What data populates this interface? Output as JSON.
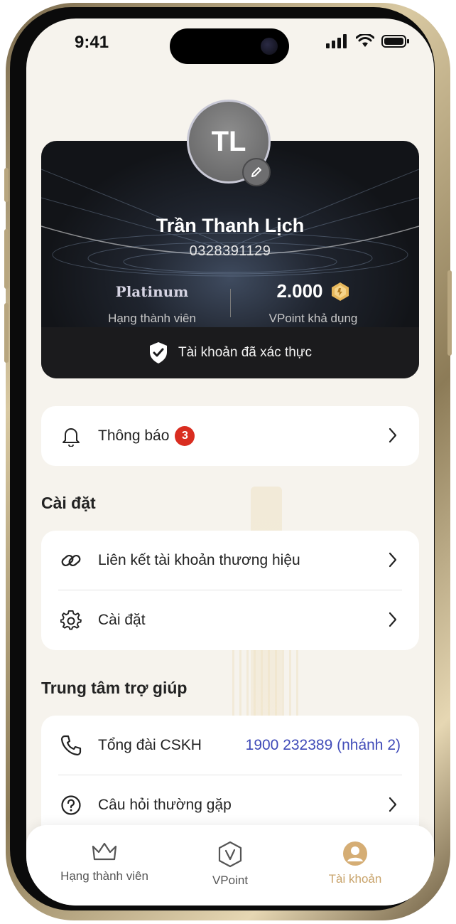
{
  "status_bar": {
    "time": "9:41"
  },
  "profile": {
    "initials": "TL",
    "name": "Trần Thanh Lịch",
    "phone": "0328391129",
    "tier": "Platinum",
    "tier_label": "Hạng thành viên",
    "vpoint": "2.000",
    "vpoint_label": "VPoint khả dụng",
    "verified_text": "Tài khoản đã xác thực"
  },
  "notifications": {
    "label": "Thông báo",
    "count": "3"
  },
  "settings": {
    "title": "Cài đặt",
    "items": [
      {
        "label": "Liên kết tài khoản thương hiệu",
        "icon": "link-icon"
      },
      {
        "label": "Cài đặt",
        "icon": "gear-icon"
      }
    ]
  },
  "help": {
    "title": "Trung tâm trợ giúp",
    "hotline_label": "Tổng đài CSKH",
    "hotline_value": "1900 232389 (nhánh 2)",
    "faq_label": "Câu hỏi thường gặp"
  },
  "bottom_nav": {
    "items": [
      {
        "label": "Hạng thành viên",
        "icon": "crown-icon"
      },
      {
        "label": "VPoint",
        "icon": "vpoint-icon"
      },
      {
        "label": "Tài khoản",
        "icon": "account-icon",
        "active": true
      }
    ]
  },
  "colors": {
    "accent": "#c8a36a",
    "badge": "#d92d20",
    "link": "#3f4ab8"
  }
}
